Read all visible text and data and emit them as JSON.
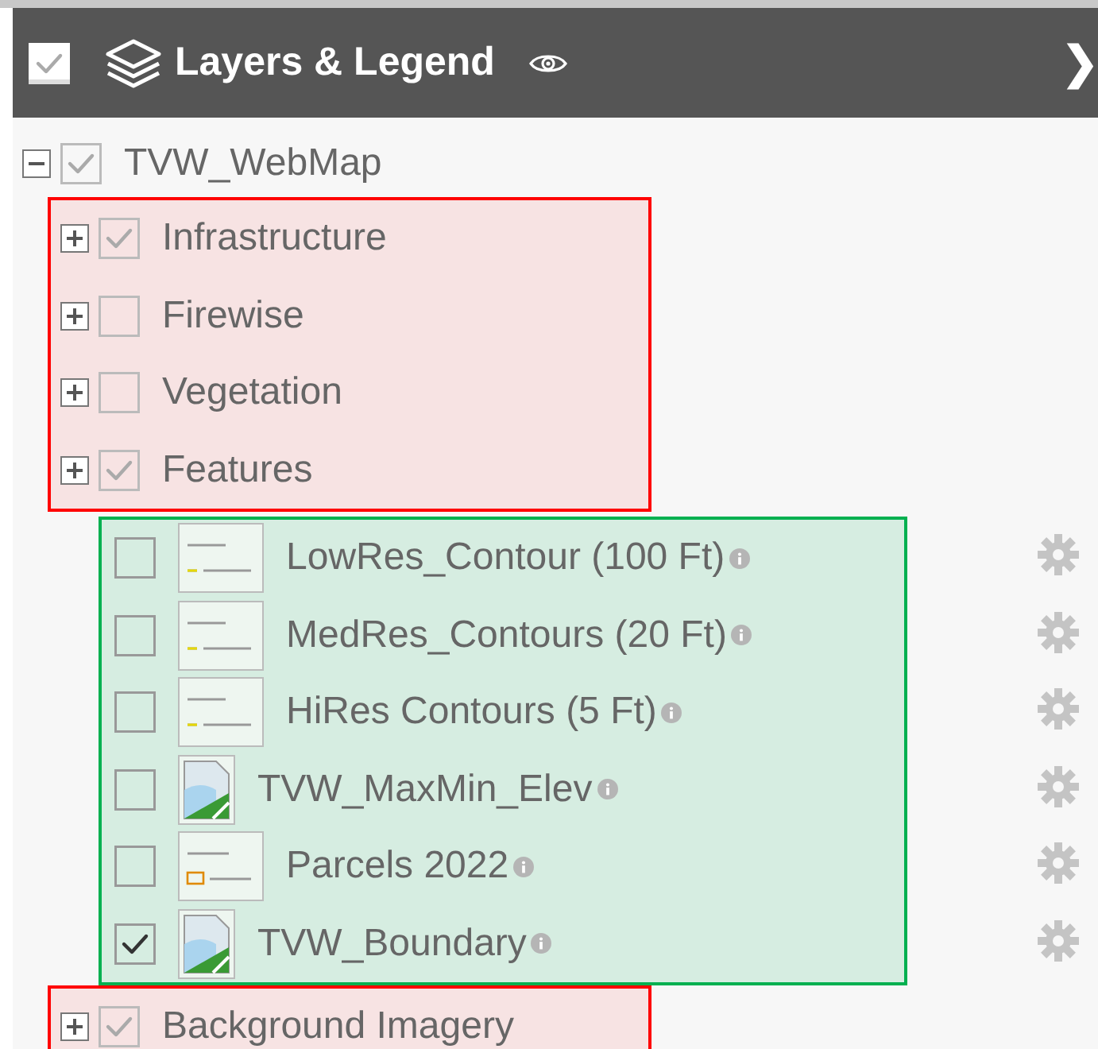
{
  "header": {
    "checked": true,
    "title": "Layers & Legend",
    "collapse_glyph": "❯"
  },
  "tree": {
    "root": {
      "label": "TVW_WebMap",
      "expanded": true,
      "checked": true
    },
    "sections": [
      {
        "kind": "groups",
        "color": "#ff0000",
        "items": [
          {
            "label": "Infrastructure",
            "expanded": false,
            "checked": true
          },
          {
            "label": "Firewise",
            "expanded": false,
            "checked": false
          },
          {
            "label": "Vegetation",
            "expanded": false,
            "checked": false
          },
          {
            "label": "Features",
            "expanded": false,
            "checked": true
          }
        ]
      },
      {
        "kind": "layers",
        "color": "#00b050",
        "items": [
          {
            "label": "LowRes_Contour (100 Ft)",
            "checked": false,
            "kind": "legend"
          },
          {
            "label": "MedRes_Contours (20 Ft)",
            "checked": false,
            "kind": "legend"
          },
          {
            "label": "HiRes Contours (5 Ft)",
            "checked": false,
            "kind": "legend"
          },
          {
            "label": "TVW_MaxMin_Elev",
            "checked": false,
            "kind": "image"
          },
          {
            "label": "Parcels 2022",
            "checked": false,
            "kind": "parcels"
          },
          {
            "label": "TVW_Boundary",
            "checked": true,
            "kind": "image"
          }
        ]
      },
      {
        "kind": "groups",
        "color": "#ff0000",
        "items": [
          {
            "label": "Background Imagery",
            "expanded": false,
            "checked": true
          }
        ]
      }
    ]
  }
}
